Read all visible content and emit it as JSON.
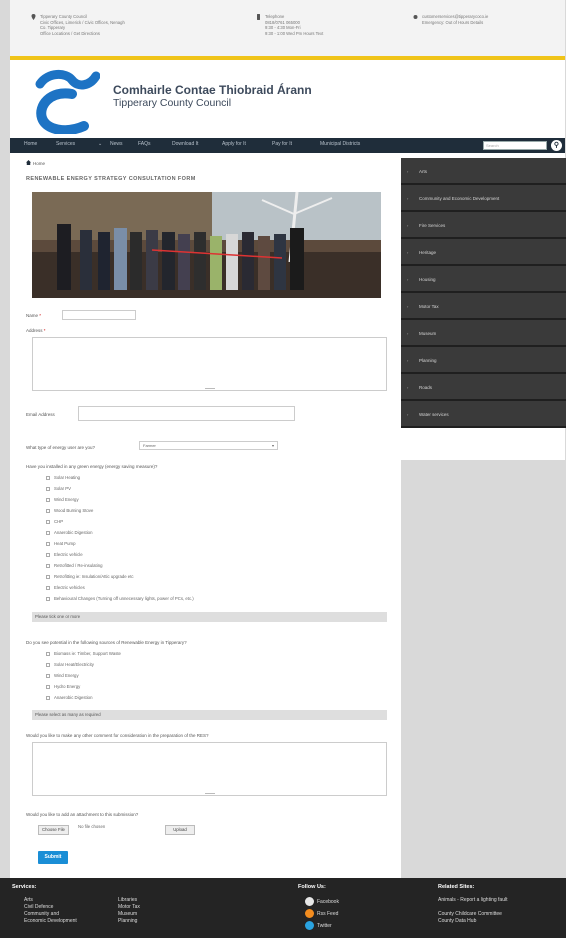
{
  "info_bar": {
    "address_lines": [
      "Tipperary County Council",
      "Civic Offices, Limerick / Civic Offices, Nenagh",
      "Co. Tipperary",
      "Office Locations / Get Directions"
    ],
    "phone_lines": [
      "Telephone",
      "0818/0761 065000",
      "9:30 - 4:30 Mon-Fri",
      "9:30 - 1:00 Wed Pm Hours Text"
    ],
    "email_lines": [
      "customerservices@tipperarycoco.ie",
      "",
      "Emergency: Out of Hours Details"
    ]
  },
  "header": {
    "council_irish": "Comhairle Contae Thiobraid Árann",
    "council_english": "Tipperary County Council",
    "brand_color": "#1d73c4"
  },
  "nav": {
    "items": [
      "Home",
      "Services",
      "News",
      "FAQs",
      "Download It",
      "Apply for It",
      "Pay for It",
      "Municipal Districts"
    ],
    "search_placeholder": "Search"
  },
  "main": {
    "breadcrumb": "Home",
    "title": "RENEWABLE ENERGY STRATEGY CONSULTATION FORM",
    "name_label": "Name",
    "address_label": "Address",
    "email_label": "Email Address",
    "energy_type_label": "What type of energy user are you?",
    "energy_type_selected": "Farmer",
    "q1": "Have you installed in any green energy (energy saving measure)?",
    "q1_options": [
      "Solar Heating",
      "Solar PV",
      "Wind Energy",
      "Wood Burning Stove",
      "CHP",
      "Anaerobic Digestion",
      "Heat Pump",
      "Electric vehicle",
      "Retrofitted / Re-insulating",
      "Retrofitting ie: Insulation/Attic upgrade etc",
      "Electric vehicles",
      "Behavioural Changes (Turning off unnecessary lights, power of PCs, etc.)"
    ],
    "q1_note": "Please tick one or more",
    "q2": "Do you see potential in the following sources of Renewable Energy in Tipperary?",
    "q2_options": [
      "Biomass ie: Timber, Support Waste",
      "Solar Heat/Electricity",
      "Wind Energy",
      "Hydro Energy",
      "Anaerobic Digestion"
    ],
    "q2_note": "Please select as many as required",
    "q3": "Would you like to make any other comment for consideration in the preparation of the RES?",
    "q4": "Would you like to add an attachment to this submission?",
    "choose_file": "Choose File",
    "no_file": "No file chosen",
    "upload": "Upload",
    "submit": "Submit"
  },
  "sidebar": {
    "items": [
      "Arts",
      "Community and Economic Development",
      "Fire Services",
      "Heritage",
      "Housing",
      "Motor Tax",
      "Museum",
      "Planning",
      "Roads",
      "Water services"
    ]
  },
  "footer": {
    "services_heading": "Services:",
    "services_col1": [
      "Arts",
      "Civil Defence",
      "Community and",
      "Economic Development"
    ],
    "services_col2": [
      "Libraries",
      "Motor Tax",
      "Museum",
      "Planning"
    ],
    "follow_heading": "Follow Us:",
    "follow": [
      "Facebook",
      "Rss Feed",
      "Twitter"
    ],
    "related_heading": "Related Sites:",
    "related": [
      "Animals - Report a lighting fault",
      "County Childcare Committee",
      "County Data Hub"
    ]
  }
}
